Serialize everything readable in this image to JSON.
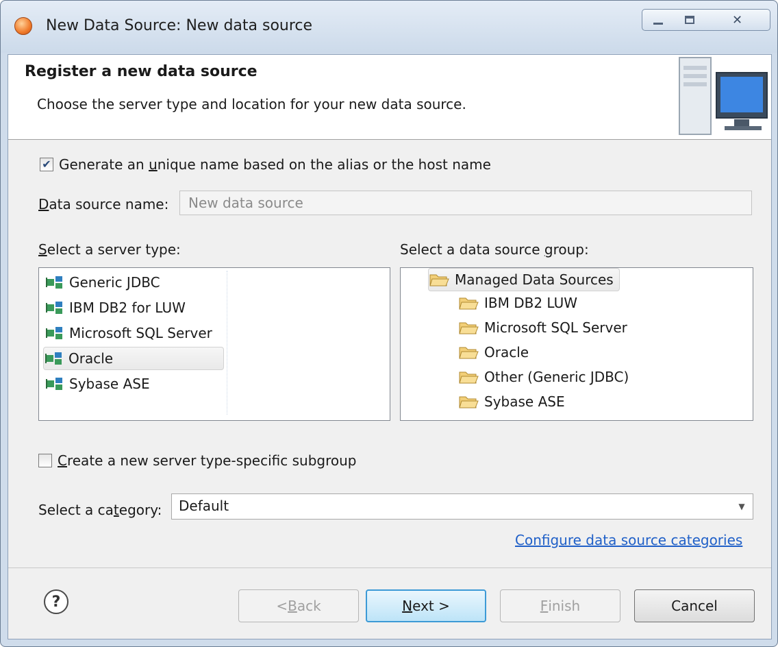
{
  "window": {
    "title": "New Data Source: New data source",
    "controls": {
      "minimize": "minimize",
      "maximize": "maximize",
      "close": "✕"
    }
  },
  "banner": {
    "title": "Register a new data source",
    "description": "Choose the server type and location for your new data source."
  },
  "form": {
    "generate_unique_name": {
      "label_pre": "Generate an ",
      "label_key": "u",
      "label_post": "nique name based on the alias or the host name",
      "checked": true
    },
    "data_source_name": {
      "label_key": "D",
      "label_post": "ata source name:",
      "value": "New data source"
    },
    "server_type": {
      "label_key": "S",
      "label_post": "elect a server type:",
      "items": [
        "Generic JDBC",
        "IBM DB2 for LUW",
        "Microsoft SQL Server",
        "Oracle",
        "Sybase ASE"
      ],
      "selected": "Oracle"
    },
    "data_source_group": {
      "label_pre": "Select a data source ",
      "label_key": "g",
      "label_post": "roup:",
      "root": "Managed Data Sources",
      "children": [
        "IBM DB2 LUW",
        "Microsoft SQL Server",
        "Oracle",
        "Other (Generic JDBC)",
        "Sybase ASE"
      ]
    },
    "create_subgroup": {
      "label_key": "C",
      "label_post": "reate a new server type-specific subgroup",
      "checked": false
    },
    "category": {
      "label_pre": "Select a ca",
      "label_key": "t",
      "label_post": "egory:",
      "value": "Default"
    },
    "configure_link": "Configure data source categories"
  },
  "buttons": {
    "back": {
      "pre": "< ",
      "key": "B",
      "post": "ack"
    },
    "next": {
      "key": "N",
      "post": "ext >"
    },
    "finish": {
      "key": "F",
      "post": "inish"
    },
    "cancel": "Cancel"
  },
  "icons": {
    "help": "?"
  }
}
